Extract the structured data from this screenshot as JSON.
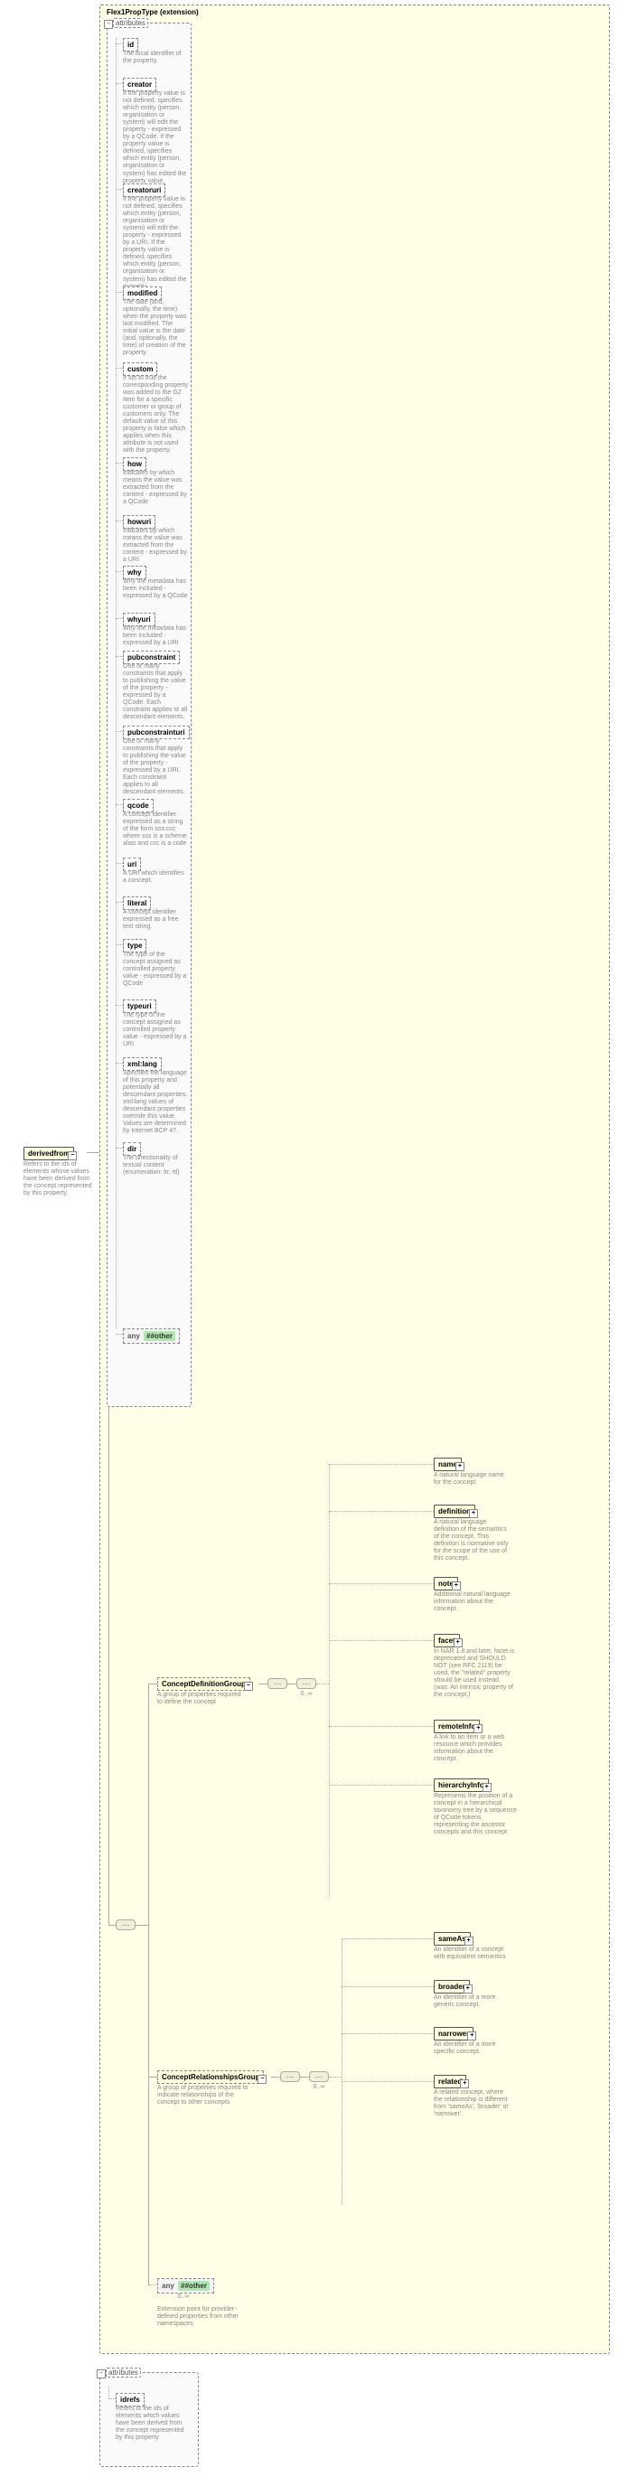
{
  "extension": {
    "label": "Flex1PropType (extension)"
  },
  "attributes_label": "attributes",
  "root": {
    "name": "derivedfrom",
    "desc": "Refers to the ids of elements whose values have been derived from the concept represented by this property."
  },
  "attributes": {
    "id": {
      "name": "id",
      "desc": "The local identifier of the property."
    },
    "creator": {
      "name": "creator",
      "desc": "If the property value is not defined, specifies which entity (person, organisation or system) will edit the property - expressed by a QCode. If the property value is defined, specifies which entity (person, organisation or system) has edited the property value."
    },
    "creatoruri": {
      "name": "creatoruri",
      "desc": "If the property value is not defined, specifies which entity (person, organisation or system) will edit the property - expressed by a URI. If the property value is defined, specifies which entity (person, organisation or system) has edited the property."
    },
    "modified": {
      "name": "modified",
      "desc": "The date (and, optionally, the time) when the property was last modified. The initial value is the date (and, optionally, the time) of creation of the property."
    },
    "custom": {
      "name": "custom",
      "desc": "If set to true the corresponding property was added to the G2 Item for a specific customer or group of customers only. The default value of this property is false which applies when this attribute is not used with the property."
    },
    "how": {
      "name": "how",
      "desc": "Indicates by which means the value was extracted from the content - expressed by a QCode"
    },
    "howuri": {
      "name": "howuri",
      "desc": "Indicates by which means the value was extracted from the content - expressed by a URI"
    },
    "why": {
      "name": "why",
      "desc": "Why the metadata has been included - expressed by a QCode"
    },
    "whyuri": {
      "name": "whyuri",
      "desc": "Why the metadata has been included - expressed by a URI"
    },
    "pubconstraint": {
      "name": "pubconstraint",
      "desc": "One or many constraints that apply to publishing the value of the property - expressed by a QCode. Each constraint applies to all descendant elements."
    },
    "pubconstrainturi": {
      "name": "pubconstrainturi",
      "desc": "One or many constraints that apply to publishing the value of the property - expressed by a URI. Each constraint applies to all descendant elements."
    },
    "qcode": {
      "name": "qcode",
      "desc": "A concept identifier expressed as a string of the form sss:ccc where sss is a scheme alias and ccc is a code"
    },
    "uri": {
      "name": "uri",
      "desc": "A URI which identifies a concept."
    },
    "literal": {
      "name": "literal",
      "desc": "A concept identifier expressed as a free text string."
    },
    "type": {
      "name": "type",
      "desc": "The type of the concept assigned as controlled property value - expressed by a QCode"
    },
    "typeuri": {
      "name": "typeuri",
      "desc": "The type of the concept assigned as controlled property value - expressed by a URI"
    },
    "xmllang": {
      "name": "xml:lang",
      "desc": "Specifies the language of this property and potentially all descendant properties. xml:lang values of descendant properties override this value. Values are determined by Internet BCP 47."
    },
    "dir": {
      "name": "dir",
      "desc": "The directionality of textual content (enumeration: ltr, rtl)"
    }
  },
  "any_top": {
    "label": "any",
    "other": "##other"
  },
  "groups": {
    "def": {
      "name": "ConceptDefinitionGroup",
      "desc": "A group of properties required to define the concept"
    },
    "rel": {
      "name": "ConceptRelationshipsGroup",
      "desc": "A group of properties required to indicate relationships of the concept to other concepts"
    }
  },
  "def_children": {
    "name": {
      "name": "name",
      "desc": "A natural language name for the concept."
    },
    "definition": {
      "name": "definition",
      "desc": "A natural language definition of the semantics of the concept. This definition is normative only for the scope of the use of this concept."
    },
    "note": {
      "name": "note",
      "desc": "Additional natural language information about the concept."
    },
    "facet": {
      "name": "facet",
      "desc": "In NAR 1.8 and later, facet is deprecated and SHOULD NOT (see RFC 2119) be used, the \"related\" property should be used instead. (was: An intrinsic property of the concept.)"
    },
    "remoteInfo": {
      "name": "remoteInfo",
      "desc": "A link to an item or a web resource which provides information about the concept."
    },
    "hierarchyInfo": {
      "name": "hierarchyInfo",
      "desc": "Represents the position of a concept in a hierarchical taxonomy tree by a sequence of QCode tokens representing the ancestor concepts and this concept"
    }
  },
  "rel_children": {
    "sameAs": {
      "name": "sameAs",
      "desc": "An identifier of a concept with equivalent semantics"
    },
    "broader": {
      "name": "broader",
      "desc": "An identifier of a more generic concept."
    },
    "narrower": {
      "name": "narrower",
      "desc": "An identifier of a more specific concept."
    },
    "related": {
      "name": "related",
      "desc": "A related concept, where the relationship is different from 'sameAs', 'broader' or 'narrower'."
    }
  },
  "any_bottom": {
    "label": "any",
    "other": "##other",
    "multi": "0..∞",
    "desc": "Extension point for provider-defined properties from other namespaces"
  },
  "attr2": {
    "label": "attributes",
    "idrefs": {
      "name": "idrefs",
      "desc": "Refers to the ids of elements which values have been derived from the concept represented by this property"
    }
  },
  "multi": "0..∞"
}
